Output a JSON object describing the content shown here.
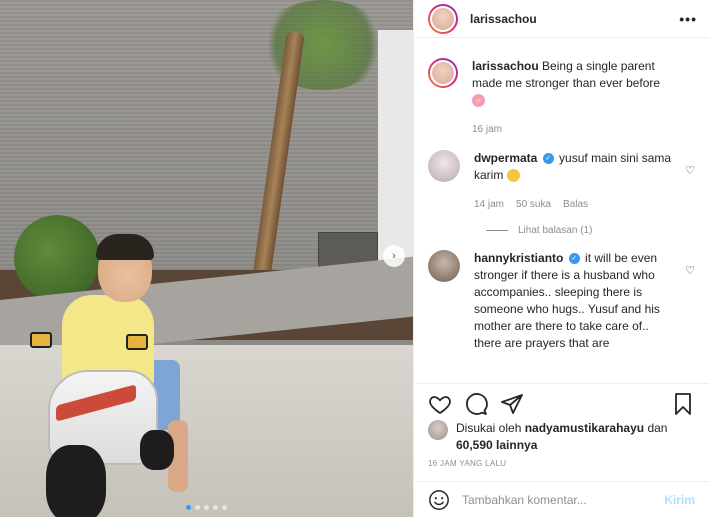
{
  "post": {
    "username": "larissachou",
    "caption_user": "larissachou",
    "caption_text": "Being a single parent made me stronger than ever before",
    "caption_time": "16 jam",
    "more_label": "•••"
  },
  "comments": [
    {
      "username": "dwpermata",
      "text": "yusuf main sini sama karim",
      "time": "14 jam",
      "likes": "50 suka",
      "reply": "Balas",
      "view_replies": "Lihat balasan (1)"
    },
    {
      "username": "hannykristianto",
      "text": "it will be even stronger if there is a husband who accompanies.. sleeping there is someone who hugs.. Yusuf and his mother are there to take care of.. there are prayers that are"
    }
  ],
  "likes": {
    "prefix": "Disukai oleh",
    "user": "nadyamustikarahayu",
    "conj": "dan",
    "others": "60,590 lainnya"
  },
  "timestamp": "16 JAM YANG LALU",
  "comment_box": {
    "placeholder": "Tambahkan komentar...",
    "post_label": "Kirim"
  },
  "carousel": {
    "next_label": "›",
    "slide_count": 5,
    "active_slide": 1
  },
  "icons": [
    "more-options-icon",
    "verified-icon",
    "small-heart-icon",
    "heart-icon",
    "comment-icon",
    "share-icon",
    "bookmark-icon",
    "emoji-icon"
  ],
  "colors": {
    "accent": "#3897f0",
    "post_button_disabled": "#b2dffc",
    "meta_text": "#8e8e8e",
    "border": "#efefef"
  }
}
